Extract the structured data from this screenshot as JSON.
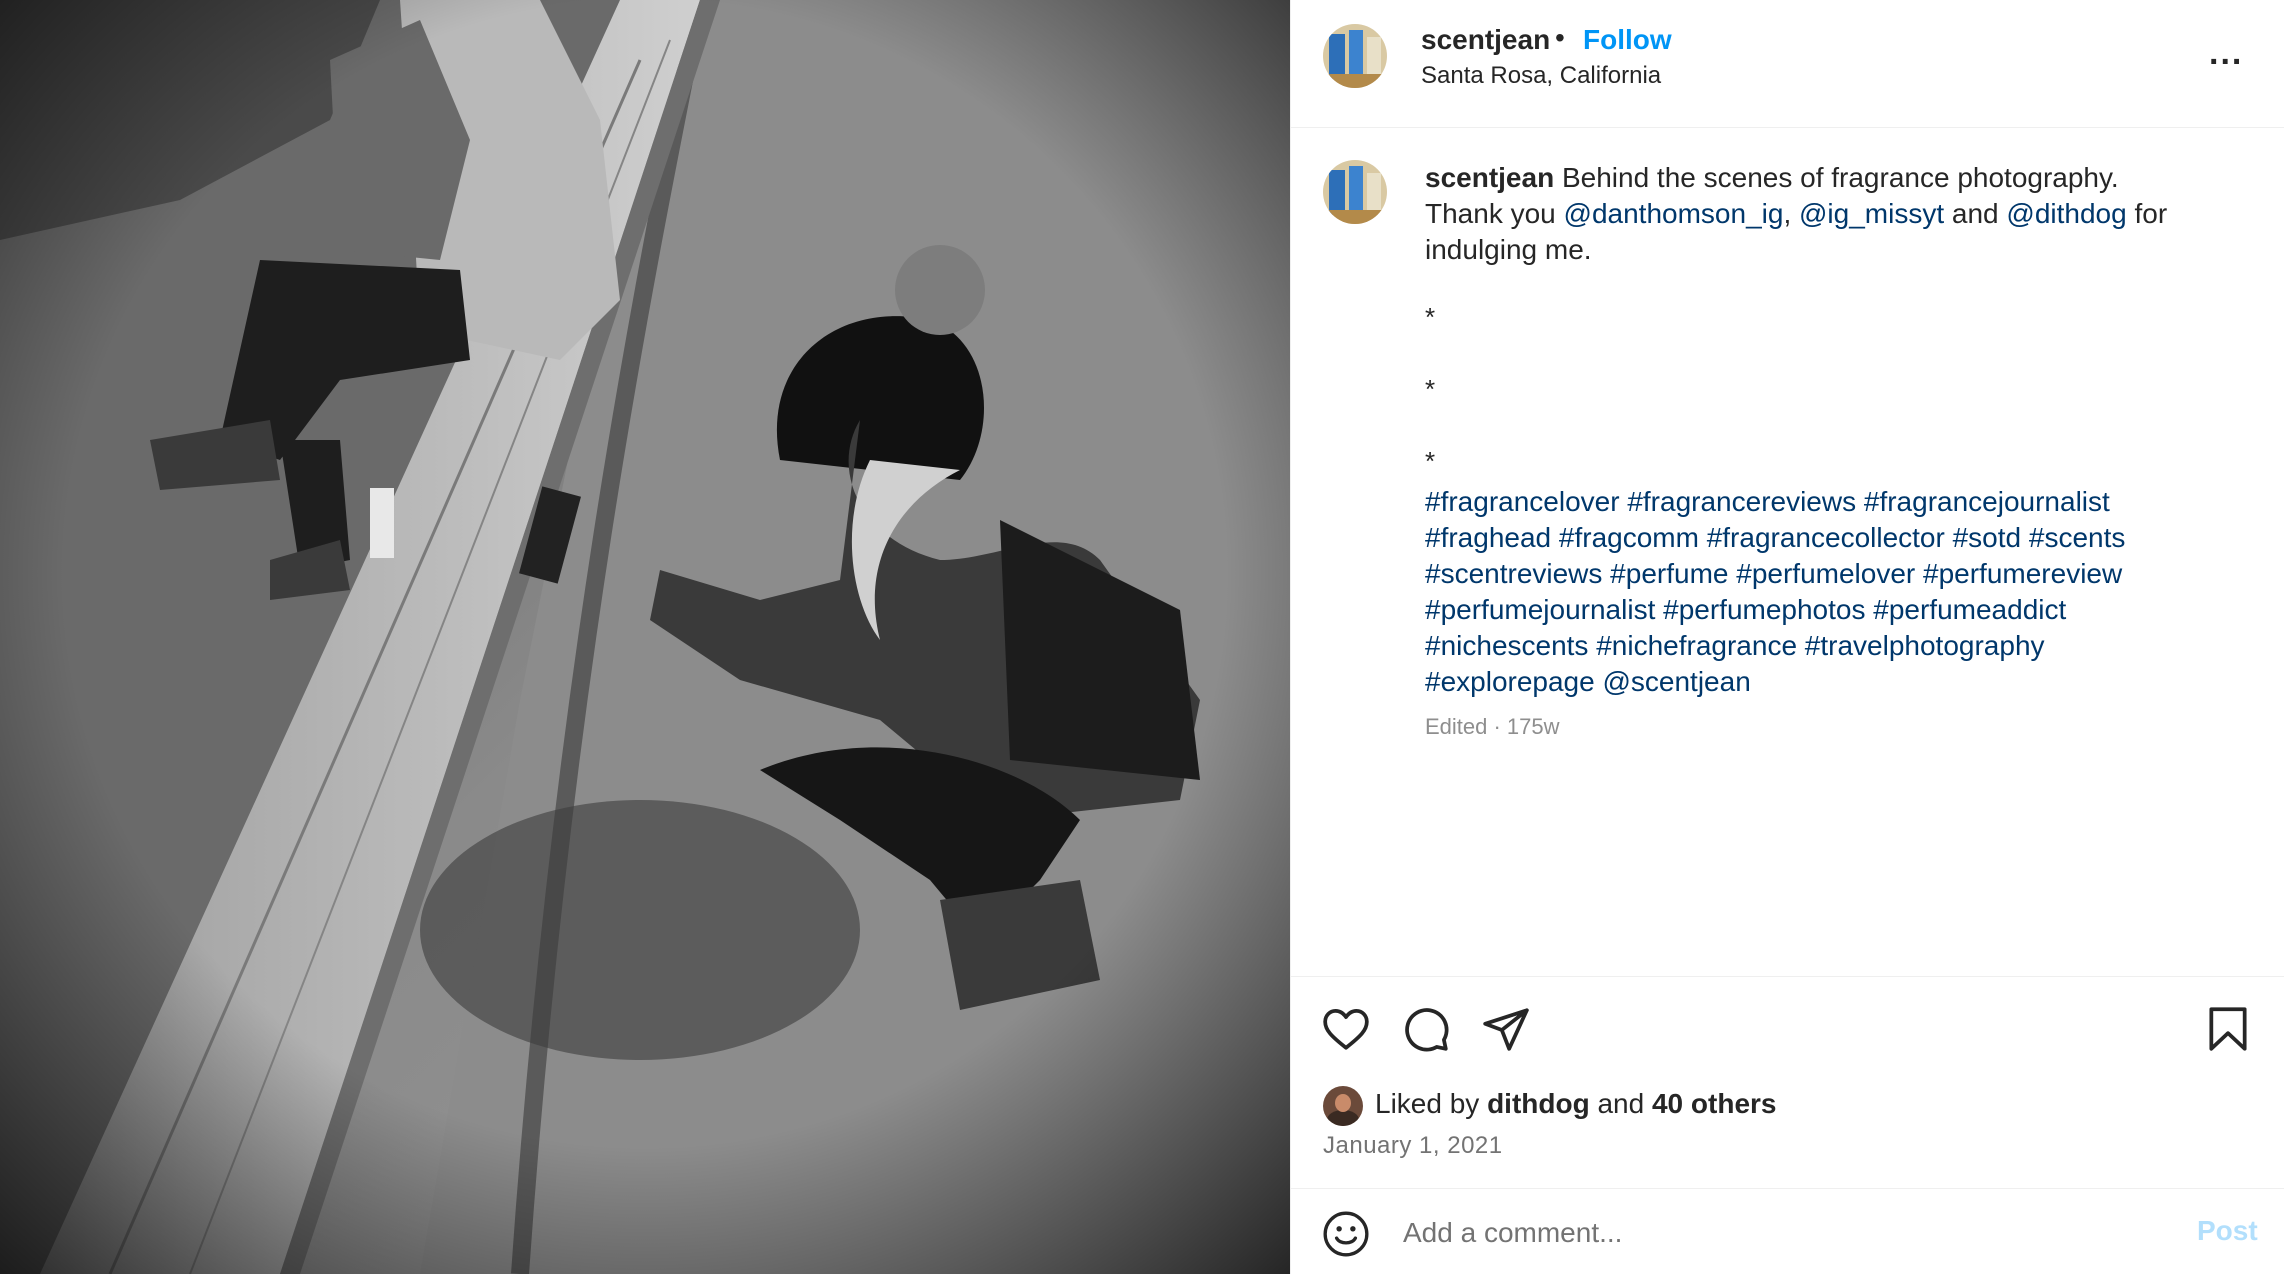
{
  "header": {
    "username": "scentjean",
    "separator": "•",
    "follow_label": "Follow",
    "location": "Santa Rosa, California",
    "more_label": "..."
  },
  "caption": {
    "username": "scentjean",
    "text_line1": "Behind the scenes of fragrance photography.",
    "thank_prefix": "Thank you ",
    "mention1": "@danthomson_ig",
    "comma": ", ",
    "mention2": "@ig_missyt",
    "and_text": " and ",
    "mention3": "@dithdog",
    "for_text": " for",
    "line3": "indulging me.",
    "stars": [
      "*",
      "*",
      "*"
    ],
    "hashtags": [
      "#fragrancelover #fragrancereviews #fragrancejournalist",
      "#fraghead #fragcomm #fragrancecollector #sotd #scents",
      "#scentreviews #perfume #perfumelover #perfumereview",
      "#perfumejournalist #perfumephotos #perfumeaddict",
      "#nichescents #nichefragrance #travelphotography",
      "#explorepage @scentjean"
    ],
    "edited": "Edited · 175w"
  },
  "actions": {
    "icons": [
      "heart-icon",
      "comment-icon",
      "share-icon",
      "bookmark-icon"
    ]
  },
  "likes": {
    "prefix": "Liked by ",
    "user": "dithdog",
    "middle": " and ",
    "others": "40 others"
  },
  "date": "January 1, 2021",
  "comment": {
    "placeholder": "Add a comment...",
    "post_label": "Post"
  },
  "colors": {
    "accent": "#0095f6",
    "link": "#00376b",
    "muted": "#8e8e8e",
    "post_disabled": "#b2dffc"
  }
}
